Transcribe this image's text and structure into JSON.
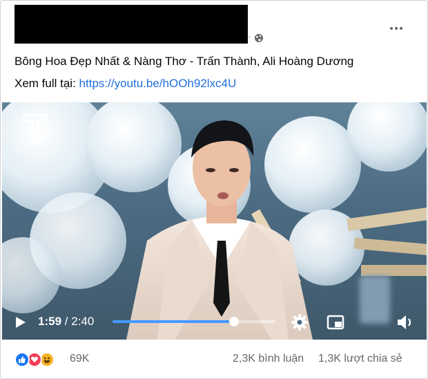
{
  "post": {
    "separator": "·",
    "globe_icon": "globe-icon",
    "more_icon": "more-options-icon",
    "title": "Bông Hoa Đẹp Nhất & Nàng Thơ - Trấn Thành, Ali Hoàng Dương",
    "link_prefix": "Xem full tại:",
    "link_url": "https://youtu.be/hOOh92lxc4U"
  },
  "video": {
    "current_time": "1:59",
    "time_separator": "/",
    "duration": "2:40",
    "progress_fraction": 0.744,
    "accent_color": "#4599ff",
    "icons": [
      "play-icon",
      "settings-gear-icon",
      "picture-in-picture-icon",
      "volume-icon"
    ]
  },
  "footer": {
    "reaction_icons": [
      "like-icon",
      "love-icon",
      "haha-icon"
    ],
    "reaction_count": "69K",
    "comments_label": "2,3K bình luận",
    "shares_label": "1,3K lượt chia sẻ"
  },
  "colors": {
    "link": "#216fdb",
    "secondary_text": "#65676b",
    "like": "#1877f2",
    "love": "#f33e58",
    "haha": "#f7b125"
  }
}
